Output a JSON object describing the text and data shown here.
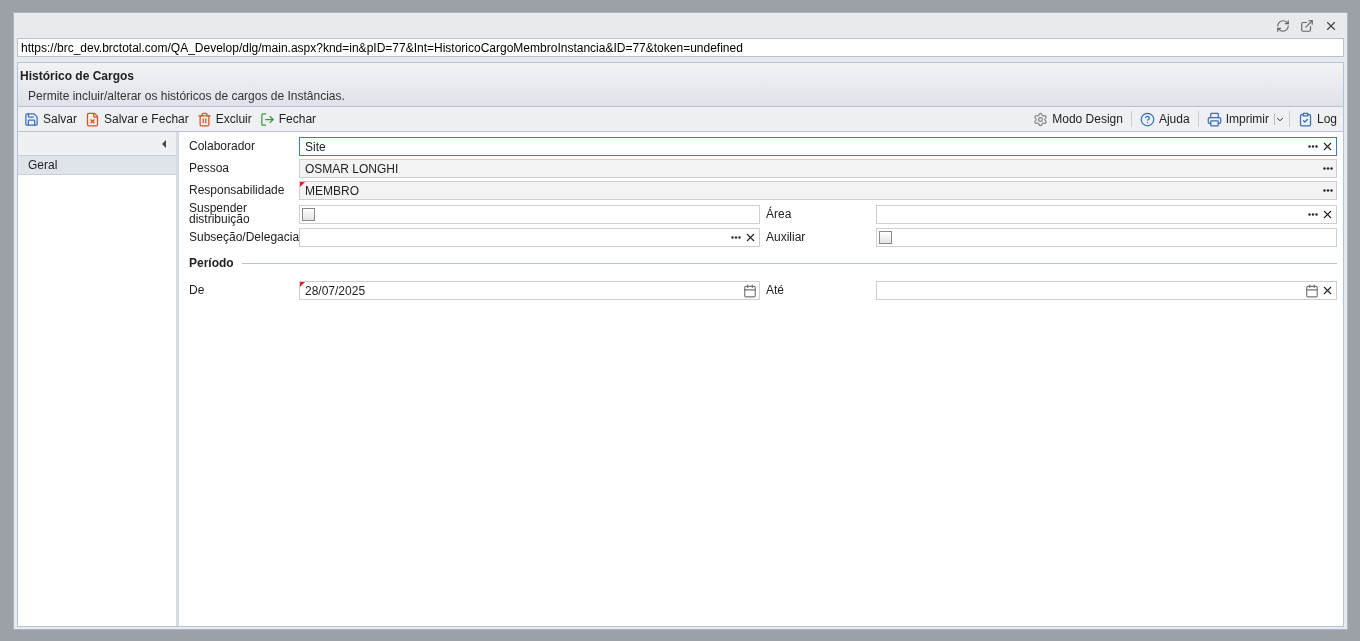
{
  "address_bar": {
    "value": "https://brc_dev.brctotal.com/QA_Develop/dlg/main.aspx?knd=in&pID=77&Int=HistoricoCargoMembroInstancia&ID=77&token=undefined"
  },
  "header": {
    "title": "Histórico de Cargos",
    "description": "Permite incluir/alterar os históricos de cargos de Instâncias."
  },
  "toolbar_left": [
    {
      "kind": "save",
      "label": "Salvar"
    },
    {
      "kind": "save_close",
      "label": "Salvar e Fechar"
    },
    {
      "kind": "delete",
      "label": "Excluir"
    },
    {
      "kind": "close",
      "label": "Fechar"
    }
  ],
  "toolbar_right": [
    {
      "kind": "design",
      "label": "Modo Design",
      "dropdown": false
    },
    {
      "kind": "help",
      "label": "Ajuda",
      "dropdown": false
    },
    {
      "kind": "print",
      "label": "Imprimir",
      "dropdown": true
    },
    {
      "kind": "log",
      "label": "Log",
      "dropdown": false
    }
  ],
  "sidebar": {
    "items": [
      {
        "label": "Geral",
        "selected": true
      }
    ]
  },
  "form_rows": [
    [
      {
        "kind": "lookup",
        "label": "Colaborador",
        "value": "Site",
        "readonly": false,
        "required": false,
        "focused": true,
        "clearable": true
      }
    ],
    [
      {
        "kind": "lookup",
        "label": "Pessoa",
        "value": "OSMAR LONGHI",
        "readonly": true,
        "required": false,
        "focused": false,
        "clearable": false
      }
    ],
    [
      {
        "kind": "lookup",
        "label": "Responsabilidade",
        "value": "MEMBRO",
        "readonly": true,
        "required": true,
        "focused": false,
        "clearable": false
      }
    ],
    [
      {
        "kind": "checkbox",
        "label": "Suspender distribuição",
        "checked": false
      },
      {
        "kind": "lookup",
        "label": "Área",
        "readonly": false,
        "required": false,
        "focused": false,
        "clearable": true
      }
    ],
    [
      {
        "kind": "lookup",
        "label": "Subseção/Delegacia",
        "readonly": false,
        "required": false,
        "focused": false,
        "clearable": true
      },
      {
        "kind": "checkbox",
        "label": "Auxiliar",
        "checked": false
      }
    ]
  ],
  "section": {
    "title": "Período"
  },
  "period_rows": [
    [
      {
        "kind": "date",
        "label": "De",
        "value": "28/07/2025",
        "readonly": false,
        "required": true,
        "focused": false,
        "clearable": false
      },
      {
        "kind": "date",
        "label": "Até",
        "readonly": false,
        "required": false,
        "focused": false,
        "clearable": true
      }
    ]
  ]
}
